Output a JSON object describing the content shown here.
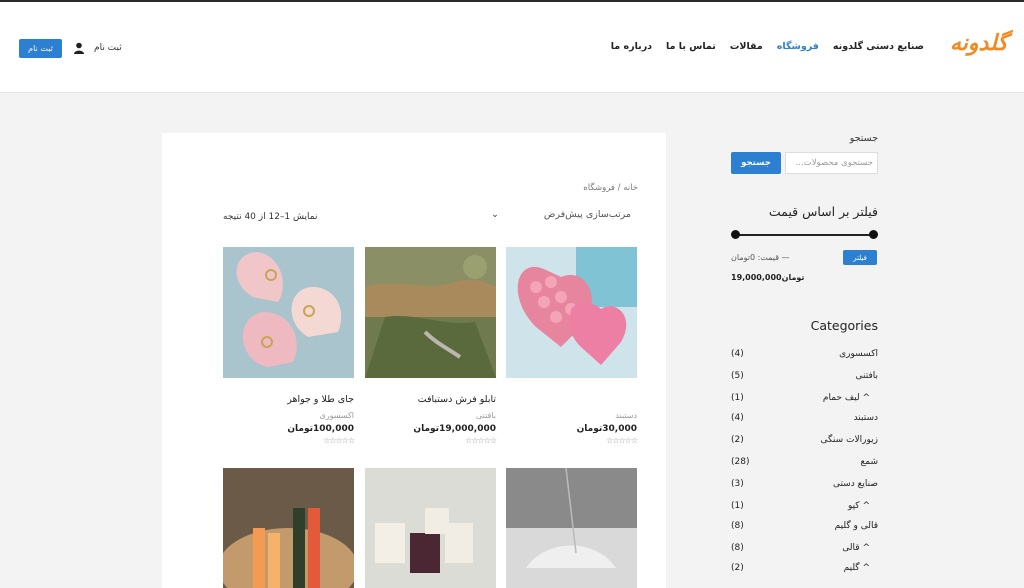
{
  "header": {
    "logo": "گلدونه",
    "nav": [
      {
        "label": "صنایع دستی گلدونه",
        "active": false
      },
      {
        "label": "فروشگاه",
        "active": true
      },
      {
        "label": "مقالات",
        "active": false
      },
      {
        "label": "تماس با ما",
        "active": false
      },
      {
        "label": "درباره ما",
        "active": false
      }
    ],
    "login_label": "ثبت نام",
    "register_button": "ثبت نام"
  },
  "shop": {
    "breadcrumb": "خانه / فروشگاه",
    "sort_label": "مرتب‌سازی پیش‌فرض",
    "result_count": "نمایش 1–12 از 40 نتیجه",
    "products": [
      {
        "title": "",
        "category": "دستبند",
        "price": "30,000تومان",
        "stars": "☆☆☆☆☆"
      },
      {
        "title": "تابلو فرش دستبافت",
        "category": "بافتنی",
        "price": "19,000,000تومان",
        "stars": "☆☆☆☆☆"
      },
      {
        "title": "جای طلا و جواهر",
        "category": "اکسسوری",
        "price": "100,000تومان",
        "stars": "☆☆☆☆☆"
      }
    ]
  },
  "sidebar": {
    "search_label": "جستجو",
    "search_placeholder": "جستجوی محصولات...",
    "search_button": "جستجو",
    "price_filter_title": "فیلتر بر اساس قیمت",
    "filter_button": "فیلتر",
    "price_text": "قیمت: 0تومان —",
    "price_max": "19,000,000تومان",
    "categories_title": "Categories",
    "categories": [
      {
        "name": "اکسسوری",
        "count": "(4)",
        "sub": false
      },
      {
        "name": "بافتنی",
        "count": "(5)",
        "sub": false
      },
      {
        "name": "^ لیف حمام",
        "count": "(1)",
        "sub": true
      },
      {
        "name": "دستبند",
        "count": "(4)",
        "sub": false
      },
      {
        "name": "زیورالات سنگی",
        "count": "(2)",
        "sub": false
      },
      {
        "name": "شمع",
        "count": "(28)",
        "sub": false
      },
      {
        "name": "صنایع دستی",
        "count": "(3)",
        "sub": false
      },
      {
        "name": "^ کپو",
        "count": "(1)",
        "sub": true
      },
      {
        "name": "قالی و گلیم",
        "count": "(8)",
        "sub": false
      },
      {
        "name": "^ قالی",
        "count": "(8)",
        "sub": true
      },
      {
        "name": "^ گلیم",
        "count": "(2)",
        "sub": true
      }
    ]
  },
  "colors": {
    "accent": "#2d7fd1",
    "logo": "#f08a24",
    "page_bg": "#f3f3f4"
  }
}
